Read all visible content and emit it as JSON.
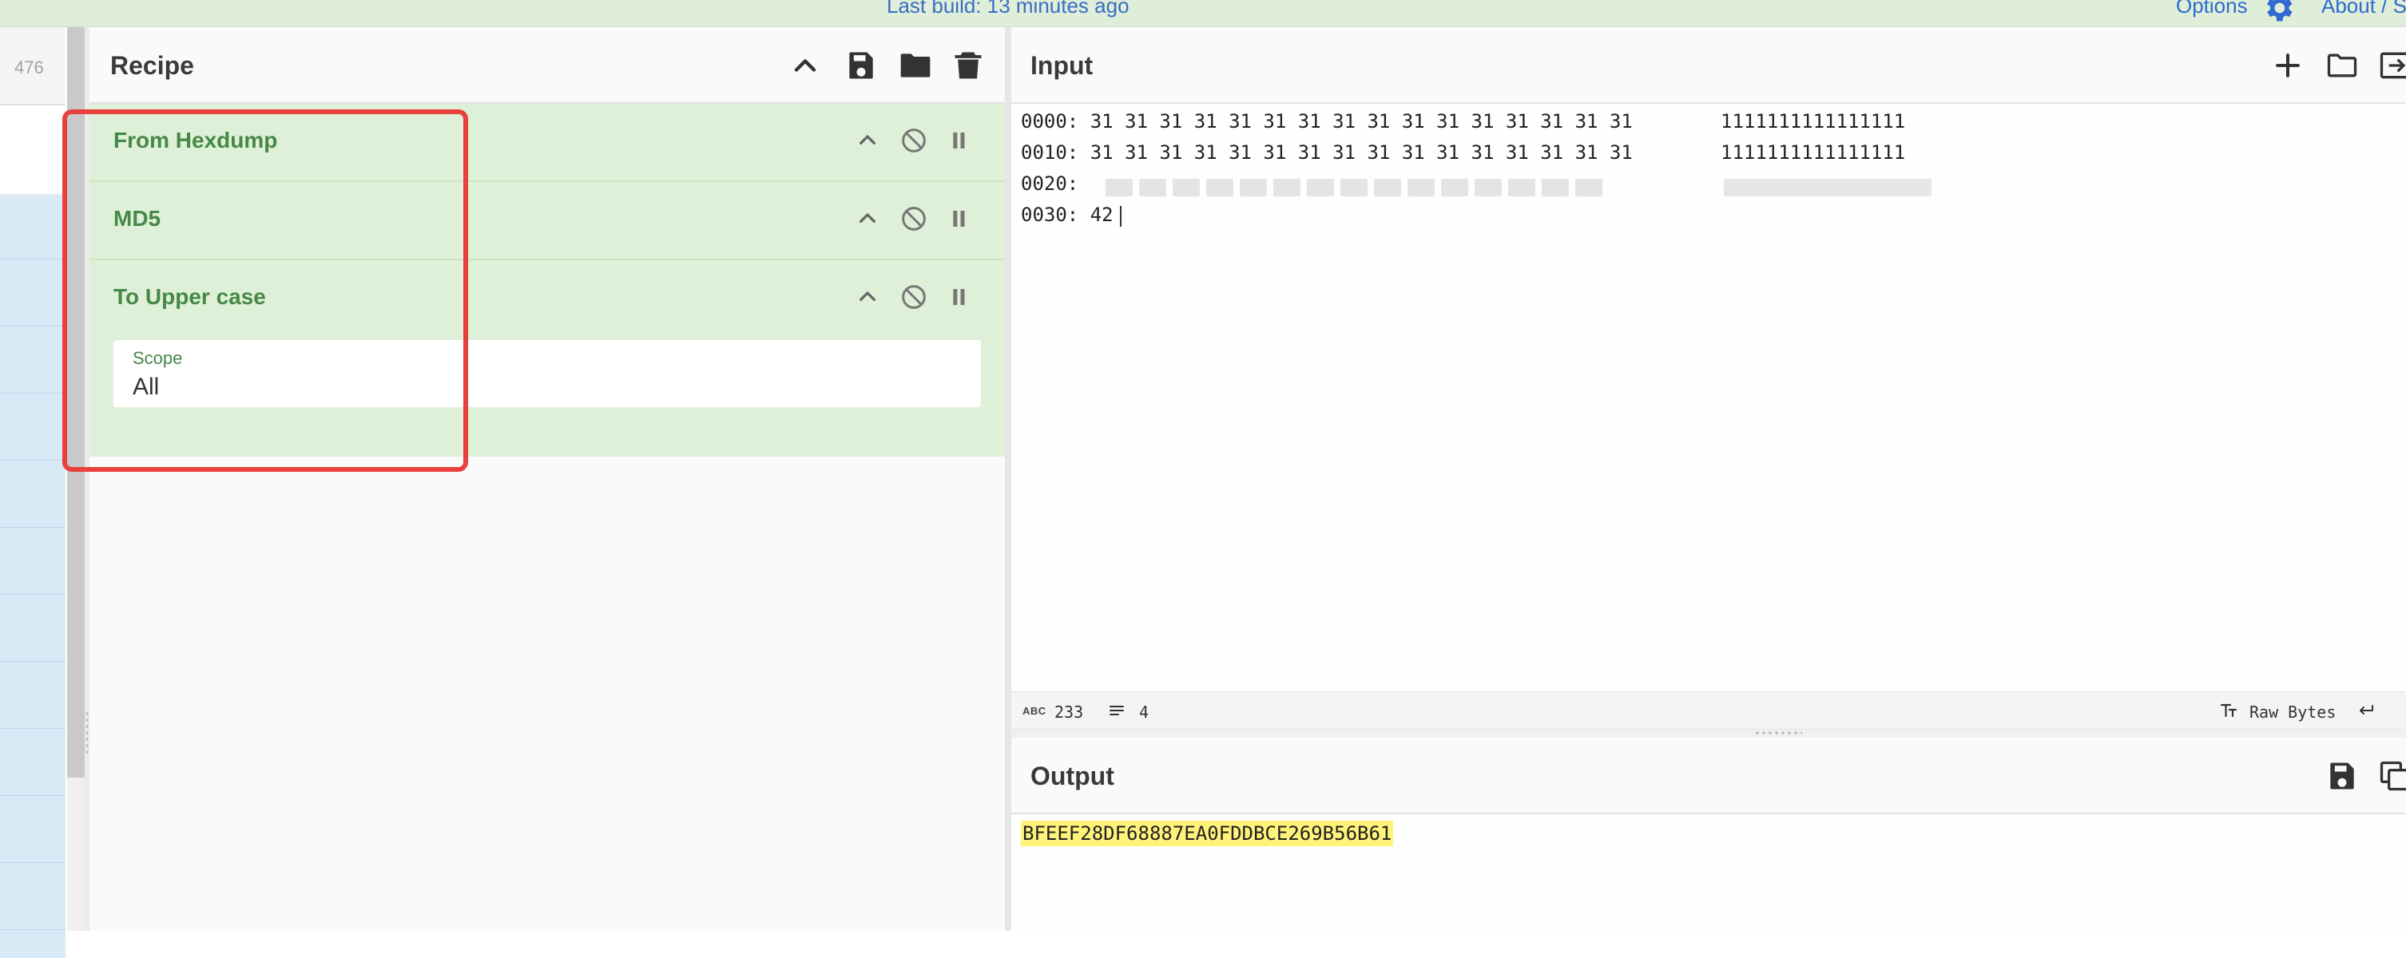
{
  "banner": {
    "status": "Last build: 13 minutes ago",
    "options_label": "Options",
    "about_label": "About / S"
  },
  "operations": {
    "count": "476"
  },
  "recipe": {
    "title": "Recipe",
    "header_icons": [
      "chevron-up-icon",
      "save-icon",
      "folder-icon",
      "trash-icon"
    ],
    "ops": [
      {
        "name": "From Hexdump"
      },
      {
        "name": "MD5"
      },
      {
        "name": "To Upper case",
        "arg_label": "Scope",
        "arg_value": "All"
      }
    ]
  },
  "input": {
    "title": "Input",
    "lines": [
      {
        "hex": "0000: 31 31 31 31 31 31 31 31 31 31 31 31 31 31 31 31",
        "ascii": "1111111111111111"
      },
      {
        "hex": "0010: 31 31 31 31 31 31 31 31 31 31 31 31 31 31 31 31",
        "ascii": "1111111111111111"
      },
      {
        "hex": "0020:",
        "ascii": ""
      },
      {
        "hex": "0030: 42",
        "ascii": ""
      }
    ],
    "status": {
      "length": "233",
      "lines": "4",
      "encoding": "Raw Bytes"
    }
  },
  "output": {
    "title": "Output",
    "value": "BFEEF28DF68887EA0FDDBCE269B56B61"
  },
  "colors": {
    "accent_green": "#468847",
    "recipe_bg": "#dff0d8",
    "highlight_red": "#e8413d",
    "output_highlight": "#fff37a",
    "link_blue": "#2f6ad0"
  }
}
